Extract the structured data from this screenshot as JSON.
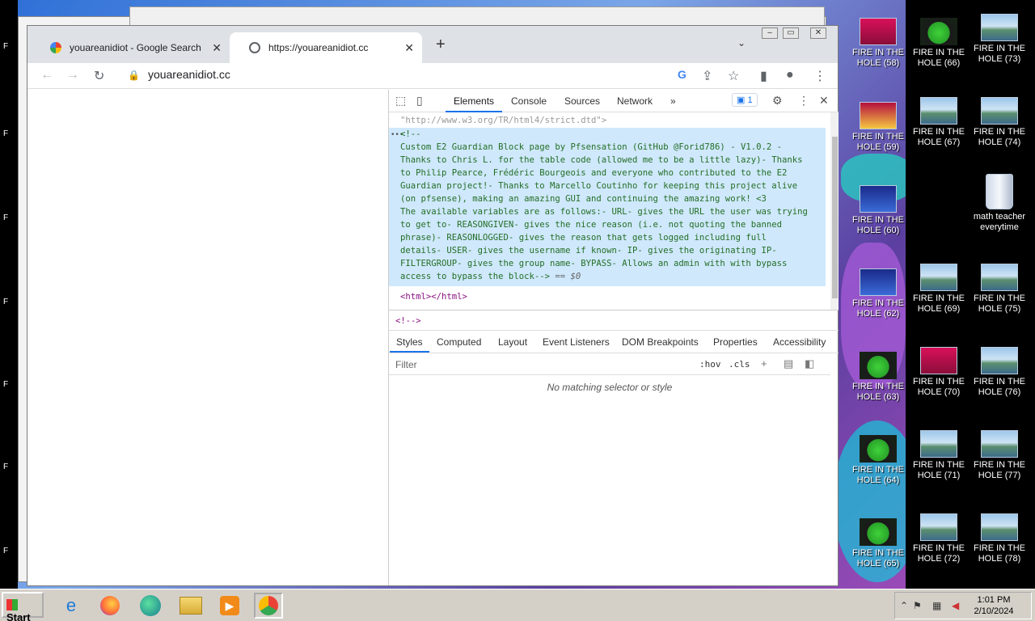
{
  "desktop": {
    "left_labels": [
      "F",
      "F",
      "F",
      "F",
      "F",
      "F",
      "F"
    ],
    "icons": [
      {
        "label": "FIRE IN THE HOLE (58)",
        "kind": "red"
      },
      {
        "label": "FIRE IN THE HOLE (59)",
        "kind": "emoji"
      },
      {
        "label": "FIRE IN THE HOLE (60)",
        "kind": "game"
      },
      {
        "label": "FIRE IN THE HOLE (62)",
        "kind": "game"
      },
      {
        "label": "FIRE IN THE HOLE (63)",
        "kind": "frog"
      },
      {
        "label": "FIRE IN THE HOLE (64)",
        "kind": "frog"
      },
      {
        "label": "FIRE IN THE HOLE (65)",
        "kind": "frog"
      },
      {
        "label": "FIRE IN THE HOLE (66)",
        "kind": "frog"
      },
      {
        "label": "FIRE IN THE HOLE (67)",
        "kind": "landscape"
      },
      {
        "label": "FIRE IN THE HOLE (69)",
        "kind": "landscape"
      },
      {
        "label": "FIRE IN THE HOLE (70)",
        "kind": "red"
      },
      {
        "label": "FIRE IN THE HOLE (71)",
        "kind": "landscape"
      },
      {
        "label": "FIRE IN THE HOLE (72)",
        "kind": "landscape"
      },
      {
        "label": "FIRE IN THE HOLE (73)",
        "kind": "landscape"
      },
      {
        "label": "FIRE IN THE HOLE (74)",
        "kind": "landscape"
      },
      {
        "label": "math teacher everytime",
        "kind": "trash"
      },
      {
        "label": "FIRE IN THE HOLE (75)",
        "kind": "landscape"
      },
      {
        "label": "FIRE IN THE HOLE (76)",
        "kind": "landscape"
      },
      {
        "label": "FIRE IN THE HOLE (77)",
        "kind": "landscape"
      },
      {
        "label": "FIRE IN THE HOLE (78)",
        "kind": "landscape"
      }
    ]
  },
  "browser": {
    "tabs": [
      {
        "title": "youareanidiot - Google Search",
        "favicon": "google-icon"
      },
      {
        "title": "https://youareanidiot.cc",
        "favicon": "globe-icon"
      }
    ],
    "new_tab": "+",
    "url": "youareanidiot.cc"
  },
  "devtools": {
    "tabs": [
      "Elements",
      "Console",
      "Sources",
      "Network"
    ],
    "more": "»",
    "issues_count": "1",
    "doctype_line": "\"http://www.w3.org/TR/html4/strict.dtd\">",
    "comment_open": "<!--",
    "comment_lines": [
      "Custom E2 Guardian Block page by Pfsensation (GitHub @Forid786) - V1.0.2 -",
      "Thanks to Chris L. for the table code (allowed me to be a little lazy)- Thanks",
      "to Philip Pearce, Frédéric Bourgeois and everyone who contributed to the E2",
      "Guardian project!- Thanks to Marcello Coutinho for keeping this project alive",
      "(on pfsense), making an amazing GUI and continuing the amazing work! <3",
      "The available variables are as follows:- URL- gives the URL the user was trying",
      "to get to- REASONGIVEN- gives the nice reason (i.e. not quoting the banned",
      "phrase)- REASONLOGGED- gives the reason that gets logged including full",
      "details- USER- gives the username if known- IP- gives the originating IP-",
      "FILTERGROUP- gives the group name- BYPASS- Allows an admin with with bypass",
      "access to bypass the block-->"
    ],
    "eq_marker": "== $0",
    "html_tag": "<html></html>",
    "breadcrumb": "<!-->",
    "subtabs": [
      "Styles",
      "Computed",
      "Layout",
      "Event Listeners",
      "DOM Breakpoints",
      "Properties",
      "Accessibility"
    ],
    "filter_placeholder": "Filter",
    "hov": ":hov",
    "cls": ".cls",
    "no_match": "No matching selector or style"
  },
  "taskbar": {
    "start": "Start",
    "apps": [
      "ie-icon",
      "firefox-icon",
      "edge-icon",
      "folder-icon",
      "media-player-icon",
      "chrome-icon"
    ],
    "time": "1:01 PM",
    "date": "2/10/2024"
  }
}
